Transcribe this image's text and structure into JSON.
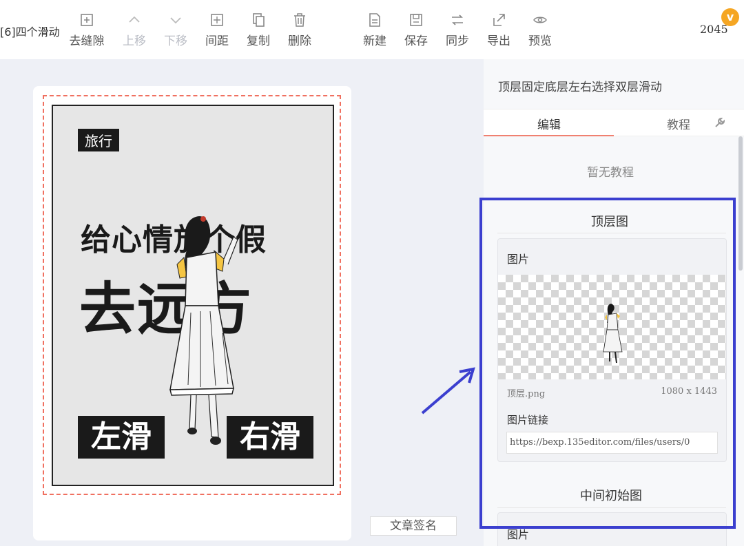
{
  "toolbar": {
    "doc_title": "[6]四个滑动",
    "buttons": {
      "remove_gap": "去缝隙",
      "move_up": "上移",
      "move_down": "下移",
      "spacing": "间距",
      "copy": "复制",
      "delete": "删除",
      "new": "新建",
      "save": "保存",
      "sync": "同步",
      "export": "导出",
      "preview": "预览"
    },
    "count": "2045",
    "vip_badge": "v"
  },
  "poster": {
    "tag": "旅行",
    "headline_line1": "给心情放个假",
    "headline_line2": "去远方",
    "swipe_left": "左滑",
    "swipe_right": "右滑"
  },
  "signature_button": "文章签名",
  "panel": {
    "title": "顶层固定底层左右选择双层滑动",
    "tabs": {
      "edit": "编辑",
      "tutorial": "教程"
    },
    "no_tutorial": "暂无教程",
    "top_layer": {
      "section_title": "顶层图",
      "image_label": "图片",
      "file_name": "顶层.png",
      "file_dims": "1080 x 1443",
      "url_label": "图片链接",
      "url_value": "https://bexp.135editor.com/files/users/0"
    },
    "middle_layer": {
      "section_title": "中间初始图",
      "image_label": "图片"
    }
  },
  "colors": {
    "accent_tab": "#f08070",
    "highlight": "#3b3fcf",
    "dashed_frame": "#f07060",
    "vip": "#f5a623"
  }
}
